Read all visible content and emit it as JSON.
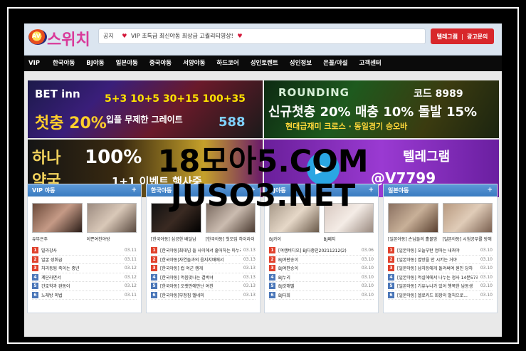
{
  "watermark": {
    "line1": "18모아5.COM",
    "line2": "JUSO3.NET"
  },
  "header": {
    "logo_badge": "AV",
    "logo_text": "스위치",
    "notice_tag": "공지",
    "notice_text": "VIP 초특급 최신야동 최상급 고퀄리티영상!",
    "btn_telegram": "텔레그램",
    "btn_ad": "광고문의"
  },
  "nav": [
    "VIP",
    "한국야동",
    "BJ야동",
    "일본야동",
    "중국야동",
    "서양야동",
    "하드코어",
    "성인토렌트",
    "성인정보",
    "은꼴/야설",
    "고객센터"
  ],
  "banners": {
    "b1": {
      "line1": "BET inn",
      "line2": "5+3 10+5 30+15 100+35",
      "line3": "첫충 20%",
      "line4": "입플 무제한 그레이트",
      "line5": "588"
    },
    "b2": {
      "line1": "ROUNDING",
      "line2": "코드 8989",
      "line3": "신규첫충 20% 매충 10% 돌발 15%",
      "line4": "현대급재미 크로스 · 동일경기 승오바"
    },
    "b3": {
      "line1": "하나",
      "line2": "약국",
      "line3": "100%",
      "line4": "1+1 이벤트 행사중"
    },
    "b4": {
      "line1": "텔레그램",
      "line2": "@V7799"
    }
  },
  "columns": [
    {
      "title": "VIP 야동",
      "thumbs": [
        "유부은주",
        "이쁜여친야방"
      ],
      "items": [
        {
          "title": "빌라강사",
          "date": "03.11"
        },
        {
          "title": "얼굴 성취급",
          "date": "03.11"
        },
        {
          "title": "처리동됨 죽이는 중년",
          "date": "03.12"
        },
        {
          "title": "계단라면서",
          "date": "03.12"
        },
        {
          "title": "간호학과 완동이",
          "date": "03.12"
        },
        {
          "title": "노래방 미법",
          "date": "03.11"
        }
      ]
    },
    {
      "title": "한국야동",
      "thumbs": [
        "[한국야동] 심공한 배달남",
        "[한국야동] 첫모임 하이라이"
      ],
      "items": [
        {
          "title": "[한국야동]최대넘 들 사이에서 줄어하는 마누라",
          "date": "03.13"
        },
        {
          "title": "[한국야동]자연들과의 음지지배에서",
          "date": "03.13"
        },
        {
          "title": "[한국야동] 컵 여군 캠게",
          "date": "03.13"
        },
        {
          "title": "[한국야동] 먹음맛나는 결박녀",
          "date": "03.13"
        },
        {
          "title": "[한국야동] 오랫만에만난 여친",
          "date": "03.13"
        },
        {
          "title": "[한국야동]부정집 벨네미",
          "date": "03.13"
        }
      ]
    },
    {
      "title": "BJ야동",
      "thumbs": [
        "BJ카이",
        "BJ페지"
      ],
      "items": [
        {
          "title": "[여캠비디오] BJ다중인20211212(2)",
          "date": "03.06"
        },
        {
          "title": "BJ여판송이",
          "date": "03.10"
        },
        {
          "title": "BJ여판송이",
          "date": "03.10"
        },
        {
          "title": "BJ누리",
          "date": "03.10"
        },
        {
          "title": "BJ갓해벨",
          "date": "03.10"
        },
        {
          "title": "BJ다희",
          "date": "03.10"
        }
      ]
    },
    {
      "title": "일본야동",
      "thumbs": [
        "[일본야동] 손님들의 홀몰밤",
        "[일본야동] 시험공부를 방해"
      ],
      "items": [
        {
          "title": "[일본야동] 오늘부턴 엄마는 내꺼야",
          "date": "03.10"
        },
        {
          "title": "[일본야동] 옆방을 안 시키는 거야",
          "date": "03.10"
        },
        {
          "title": "[일본야동] 남자등에게 돌려써여 원인 당하",
          "date": "03.10"
        },
        {
          "title": "[일본야동] 먹실에에서 나누는 정사 14분57초",
          "date": "03.10"
        },
        {
          "title": "[일본야동] 기유누나가 있어 행복한 남동생",
          "date": "03.10"
        },
        {
          "title": "[일본야동] 엘로커드 회장의 벌칙으로...",
          "date": "03.10"
        }
      ]
    }
  ]
}
